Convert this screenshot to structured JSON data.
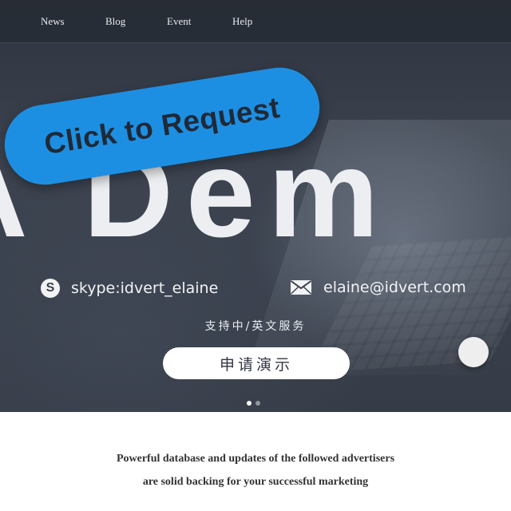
{
  "nav": {
    "items": [
      {
        "label": "News"
      },
      {
        "label": "Blog"
      },
      {
        "label": "Event"
      },
      {
        "label": "Help"
      }
    ]
  },
  "hero": {
    "big_text": "A Dem",
    "request_pill_label": "Click to Request",
    "pill_color": "#1d8fe3",
    "skype_icon_glyph": "S",
    "skype_text": "skype:idvert_elaine",
    "email_text": "elaine@idvert.com",
    "support_text": "支持中/英文服务",
    "demo_button_label": "申请演示",
    "carousel": {
      "slide_count": 2,
      "active_index": 0
    }
  },
  "description": {
    "line1": "Powerful database and updates of the followed advertisers",
    "line2": "are solid backing for your successful marketing"
  }
}
